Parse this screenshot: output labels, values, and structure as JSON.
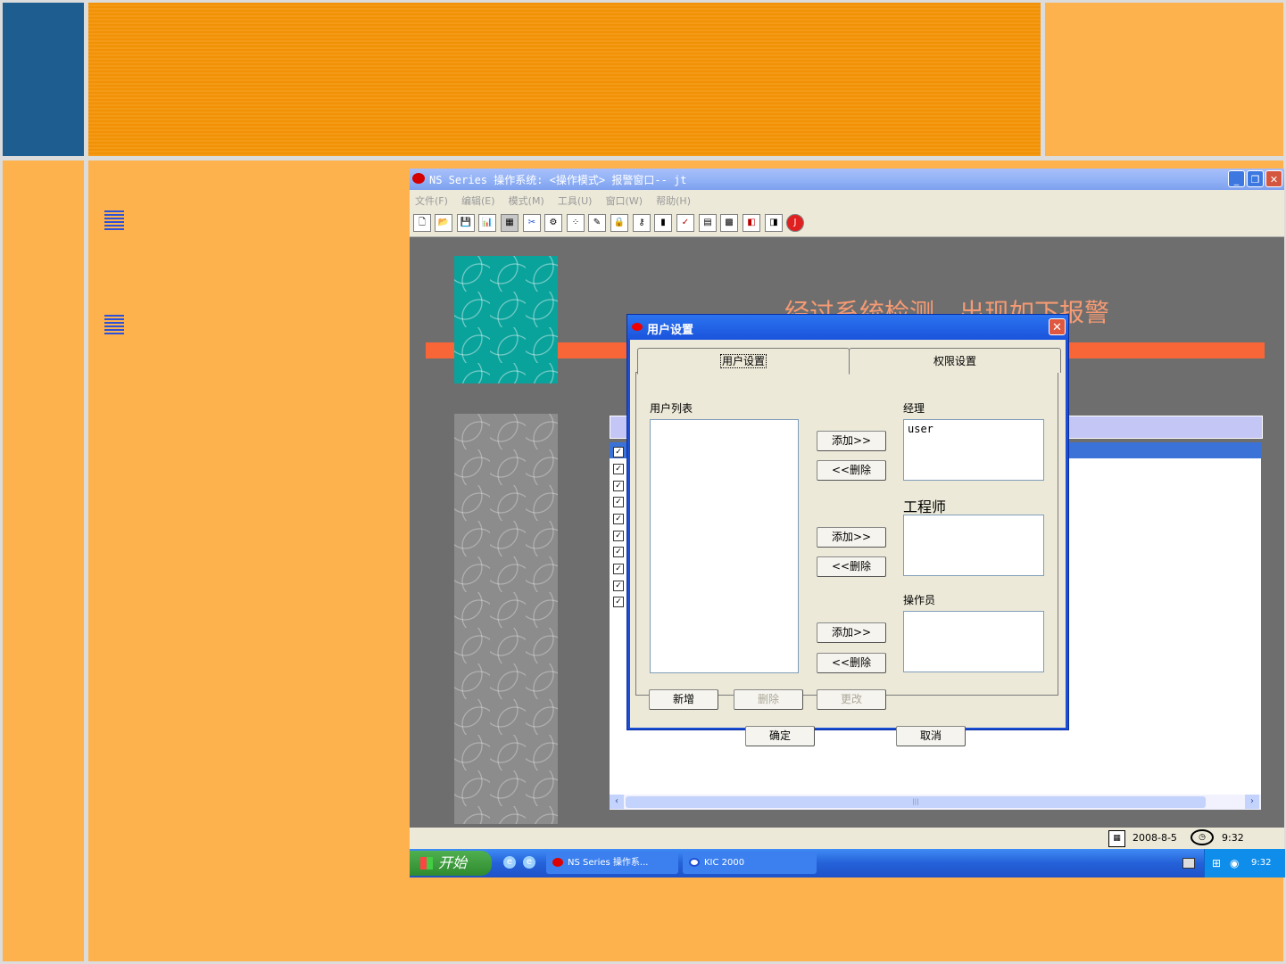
{
  "app": {
    "title": "NS Series 操作系统: <操作模式> 报警窗口-- jt",
    "menu": [
      "文件(F)",
      "编辑(E)",
      "模式(M)",
      "工具(U)",
      "窗口(W)",
      "帮助(H)"
    ],
    "toolbar_icons": [
      "new-file",
      "open-folder",
      "save",
      "chart",
      "grid",
      "tools",
      "config",
      "dots",
      "eraser",
      "lock",
      "key",
      "plug",
      "report",
      "table",
      "graph",
      "exit-red",
      "exit-green",
      "logo"
    ],
    "alarm_heading": "经过系统检测，出现如下报警",
    "status": {
      "date": "2008-8-5",
      "time": "9:32"
    }
  },
  "taskbar": {
    "start": "开始",
    "tasks": [
      "NS Series 操作系...",
      "KIC 2000"
    ],
    "clock": "9:32"
  },
  "dialog": {
    "title": "用户设置",
    "close": "✕",
    "tabs": [
      "用户设置",
      "权限设置"
    ],
    "user_list_label": "用户列表",
    "groups": [
      {
        "label": "经理",
        "users": [
          "user"
        ]
      },
      {
        "label": "工程师",
        "users": []
      },
      {
        "label": "操作员",
        "users": []
      }
    ],
    "add_label": "添加>>",
    "remove_label": "<<删除",
    "new_label": "新增",
    "delete_label": "删除",
    "modify_label": "更改",
    "ok_label": "确定",
    "cancel_label": "取消"
  },
  "colors": {
    "accent_orange": "#feb24d",
    "title_blue": "#1d5d8f",
    "xp_blue": "#2461d8"
  }
}
